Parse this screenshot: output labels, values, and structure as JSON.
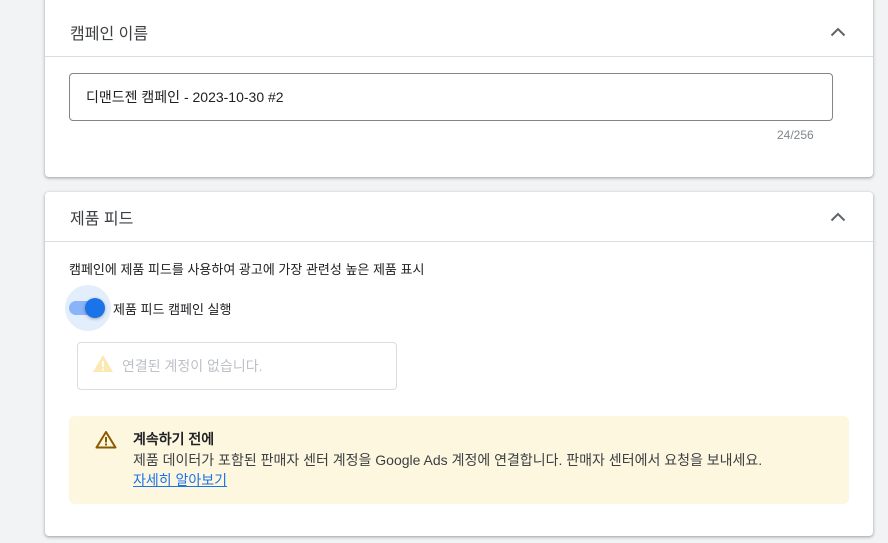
{
  "campaign_name_card": {
    "title": "캠페인 이름",
    "input_value": "디맨드젠 캠페인 - 2023-10-30 #2",
    "counter": "24/256"
  },
  "product_feed_card": {
    "title": "제품 피드",
    "description": "캠페인에 제품 피드를 사용하여 광고에 가장 관련성 높은 제품 표시",
    "toggle_label": "제품 피드 캠페인 실행",
    "toggle_on": true,
    "no_account_text": "연결된 계정이 없습니다.",
    "notice": {
      "title": "계속하기 전에",
      "body": "제품 데이터가 포함된 판매자 센터 계정을 Google Ads 계정에 연결합니다. 판매자 센터에서 요청을 보내세요.",
      "link": "자세히 알아보기"
    }
  },
  "colors": {
    "accent": "#1a73e8",
    "notice_bg": "#fef7e0",
    "warning": "#f9ab00"
  }
}
